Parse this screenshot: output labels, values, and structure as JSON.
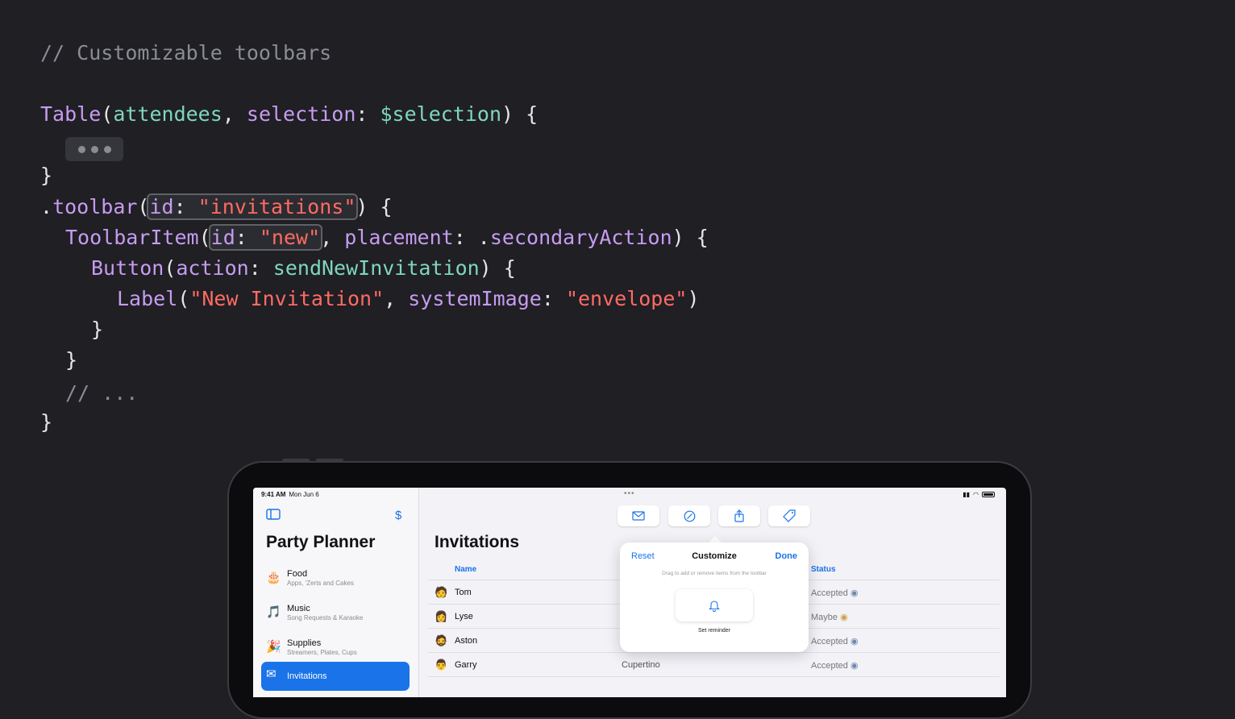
{
  "code": {
    "comment_title": "// Customizable toolbars",
    "table_fn": "Table",
    "table_arg": "attendees",
    "selection_label": "selection",
    "selection_binding": "$selection",
    "toolbar_fn": "toolbar",
    "toolbar_id_label": "id",
    "toolbar_id_value": "\"invitations\"",
    "item_fn": "ToolbarItem",
    "item_id_label": "id",
    "item_id_value": "\"new\"",
    "placement_label": "placement",
    "placement_value": "secondaryAction",
    "button_fn": "Button",
    "action_label": "action",
    "action_value": "sendNewInvitation",
    "label_fn": "Label",
    "label_title": "\"New Invitation\"",
    "system_image_label": "systemImage",
    "system_image_value": "\"envelope\"",
    "trailing_comment": "// ..."
  },
  "ipad": {
    "status_time": "9:41 AM",
    "status_date": "Mon Jun 6",
    "sidebar": {
      "title": "Party Planner",
      "toggle_icon": "sidebar-icon",
      "dollar_icon": "$",
      "items": [
        {
          "title": "Food",
          "subtitle": "Apps, 'Zerts and Cakes",
          "icon": "🎂"
        },
        {
          "title": "Music",
          "subtitle": "Song Requests & Karaoke",
          "icon": "🎵"
        },
        {
          "title": "Supplies",
          "subtitle": "Streamers, Plates, Cups",
          "icon": "🎉"
        },
        {
          "title": "Invitations",
          "subtitle": "",
          "icon": "✉"
        }
      ]
    },
    "main_title": "Invitations",
    "toolbar_icons": [
      "envelope-icon",
      "checkmark-circle-icon",
      "share-icon",
      "tag-icon"
    ],
    "columns": {
      "name": "Name",
      "status": "Status"
    },
    "rows": [
      {
        "avatar": "🧑",
        "name": "Tom",
        "location": "",
        "status": "Accepted"
      },
      {
        "avatar": "👩",
        "name": "Lyse",
        "location": "",
        "status": "Maybe"
      },
      {
        "avatar": "🧔",
        "name": "Aston",
        "location": "",
        "status": "Accepted"
      },
      {
        "avatar": "👨",
        "name": "Garry",
        "location": "Cupertino",
        "status": "Accepted"
      }
    ],
    "popover": {
      "reset": "Reset",
      "title": "Customize",
      "done": "Done",
      "hint": "Drag to add or remove items from the toolbar",
      "tile_label": "Set reminder",
      "tile_icon": "bell-icon"
    }
  }
}
